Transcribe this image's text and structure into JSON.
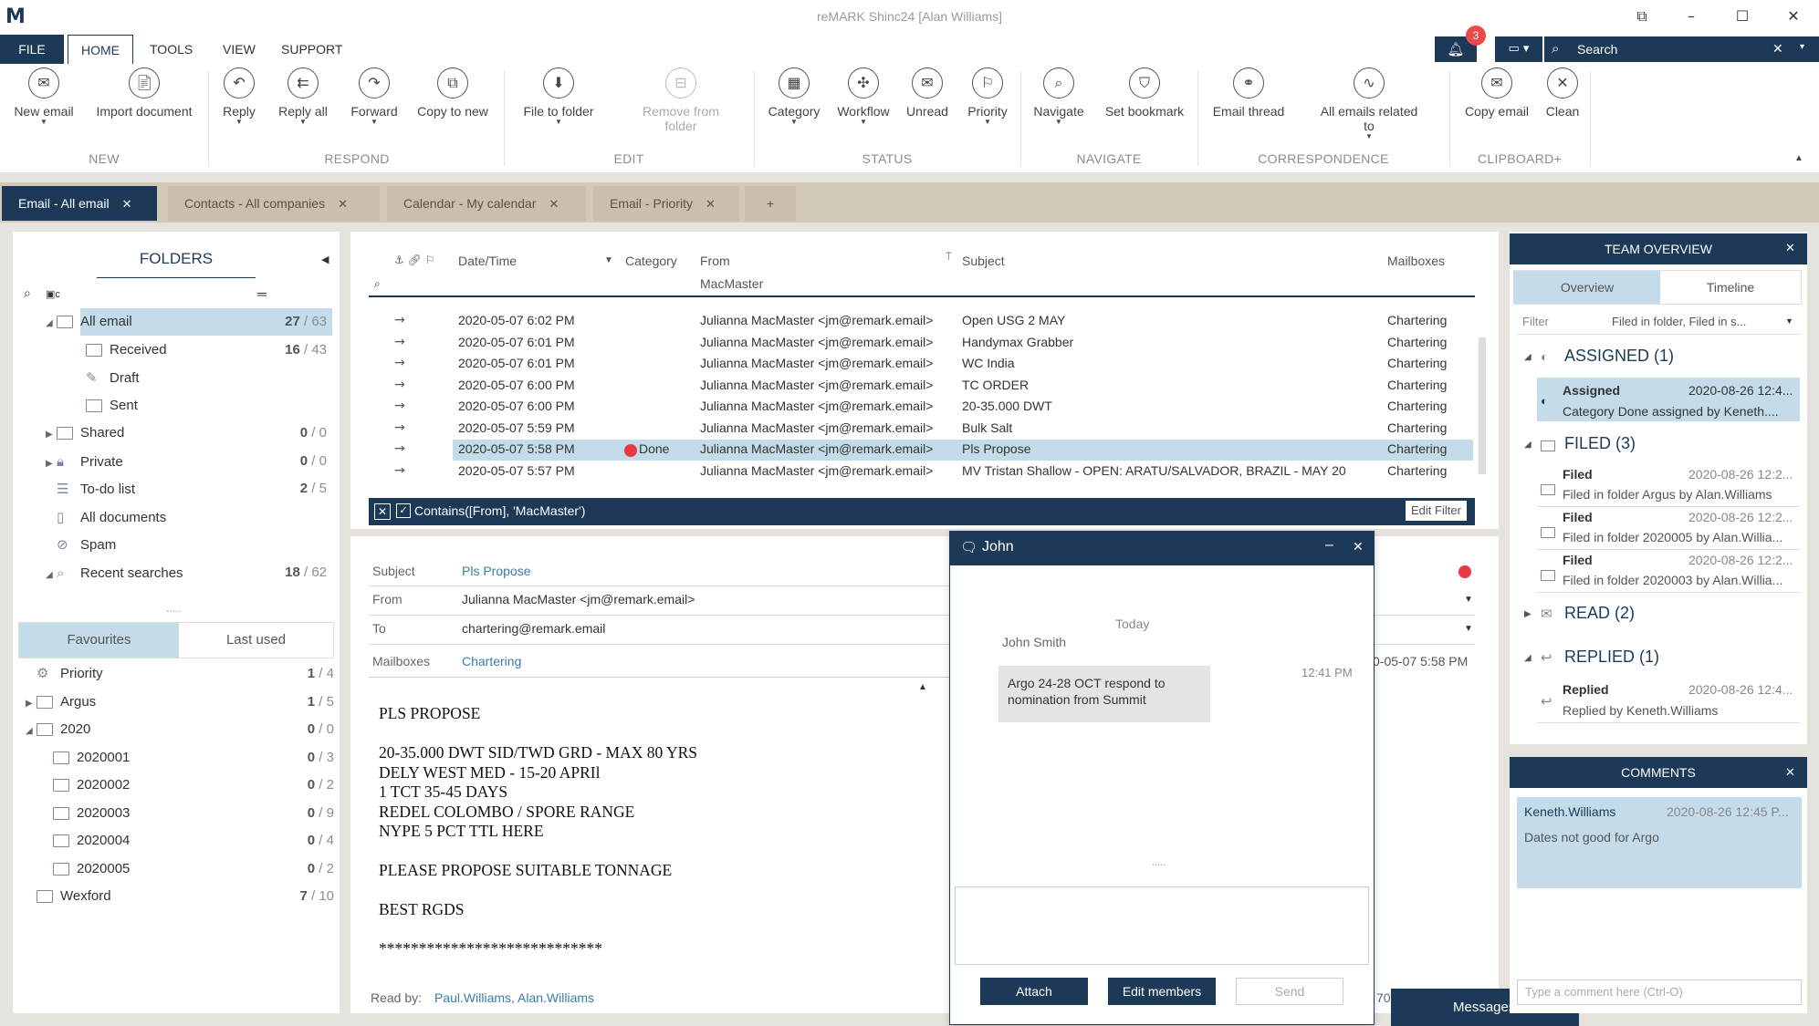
{
  "window": {
    "title": "reMARK Shinc24 [Alan Williams]",
    "logo": "M"
  },
  "menu": {
    "file": "FILE",
    "home": "HOME",
    "tools": "TOOLS",
    "view": "VIEW",
    "support": "SUPPORT"
  },
  "notifications": {
    "count": "3"
  },
  "search": {
    "placeholder": "Search"
  },
  "ribbon": {
    "buttons": [
      {
        "label": "New email"
      },
      {
        "label": "Import document"
      },
      {
        "label": "Reply"
      },
      {
        "label": "Reply all"
      },
      {
        "label": "Forward"
      },
      {
        "label": "Copy to new"
      },
      {
        "label": "File to folder"
      },
      {
        "label": "Remove from folder"
      },
      {
        "label": "Category"
      },
      {
        "label": "Workflow"
      },
      {
        "label": "Unread"
      },
      {
        "label": "Priority"
      },
      {
        "label": "Navigate"
      },
      {
        "label": "Set bookmark"
      },
      {
        "label": "Email thread"
      },
      {
        "label": "All emails related to"
      },
      {
        "label": "Copy email"
      },
      {
        "label": "Clean"
      }
    ],
    "groups": [
      "NEW",
      "RESPOND",
      "EDIT",
      "STATUS",
      "NAVIGATE",
      "CORRESPONDENCE",
      "CLIPBOARD+"
    ]
  },
  "tabs": [
    {
      "label": "Email - All email"
    },
    {
      "label": "Contacts - All companies"
    },
    {
      "label": "Calendar - My calendar"
    },
    {
      "label": "Email - Priority"
    },
    {
      "label": "+"
    }
  ],
  "folders": {
    "title": "FOLDERS",
    "items": [
      {
        "label": "All email",
        "count": "27",
        "total": "63"
      },
      {
        "label": "Received",
        "count": "16",
        "total": "43"
      },
      {
        "label": "Draft"
      },
      {
        "label": "Sent"
      },
      {
        "label": "Shared",
        "count": "0",
        "total": "0"
      },
      {
        "label": "Private",
        "count": "0",
        "total": "0"
      },
      {
        "label": "To-do list",
        "count": "2",
        "total": "5"
      },
      {
        "label": "All documents"
      },
      {
        "label": "Spam"
      },
      {
        "label": "Recent searches",
        "count": "18",
        "total": "62"
      }
    ],
    "more": "....."
  },
  "favourites": {
    "tabs": [
      "Favourites",
      "Last used"
    ],
    "items": [
      {
        "label": "Priority",
        "count": "1",
        "total": "4"
      },
      {
        "label": "Argus",
        "count": "1",
        "total": "5"
      },
      {
        "label": "2020",
        "count": "0",
        "total": "0"
      },
      {
        "label": "2020001",
        "count": "0",
        "total": "3"
      },
      {
        "label": "2020002",
        "count": "0",
        "total": "2"
      },
      {
        "label": "2020003",
        "count": "0",
        "total": "9"
      },
      {
        "label": "2020004",
        "count": "0",
        "total": "4"
      },
      {
        "label": "2020005",
        "count": "0",
        "total": "2"
      },
      {
        "label": "Wexford",
        "count": "7",
        "total": "10"
      }
    ]
  },
  "email_list": {
    "columns": {
      "datetime": "Date/Time",
      "category": "Category",
      "from": "From",
      "subject": "Subject",
      "mailboxes": "Mailboxes"
    },
    "from_filter": "MacMaster",
    "rows": [
      {
        "date": "2020-05-07 6:02 PM",
        "category": "",
        "from": "Julianna MacMaster <jm@remark.email>",
        "subject": "Open USG 2 MAY",
        "mailbox": "Chartering"
      },
      {
        "date": "2020-05-07 6:01 PM",
        "category": "",
        "from": "Julianna MacMaster <jm@remark.email>",
        "subject": "Handymax Grabber",
        "mailbox": "Chartering"
      },
      {
        "date": "2020-05-07 6:01 PM",
        "category": "",
        "from": "Julianna MacMaster <jm@remark.email>",
        "subject": "WC India",
        "mailbox": "Chartering"
      },
      {
        "date": "2020-05-07 6:00 PM",
        "category": "",
        "from": "Julianna MacMaster <jm@remark.email>",
        "subject": "TC ORDER",
        "mailbox": "Chartering"
      },
      {
        "date": "2020-05-07 6:00 PM",
        "category": "",
        "from": "Julianna MacMaster <jm@remark.email>",
        "subject": "20-35.000 DWT",
        "mailbox": "Chartering"
      },
      {
        "date": "2020-05-07 5:59 PM",
        "category": "",
        "from": "Julianna MacMaster <jm@remark.email>",
        "subject": "Bulk Salt",
        "mailbox": "Chartering"
      },
      {
        "date": "2020-05-07 5:58 PM",
        "category": "Done",
        "from": "Julianna MacMaster <jm@remark.email>",
        "subject": "Pls Propose",
        "mailbox": "Chartering"
      },
      {
        "date": "2020-05-07 5:57 PM",
        "category": "",
        "from": "Julianna MacMaster <jm@remark.email>",
        "subject": "MV Tristan Shallow - OPEN: ARATU/SALVADOR, BRAZIL - MAY 20",
        "mailbox": "Chartering"
      }
    ],
    "filter_text": "Contains([From], 'MacMaster')",
    "edit_filter": "Edit Filter"
  },
  "preview": {
    "labels": {
      "subject": "Subject",
      "from": "From",
      "to": "To",
      "mailboxes": "Mailboxes"
    },
    "subject": "Pls Propose",
    "from": "Julianna MacMaster <jm@remark.email>",
    "to": "chartering@remark.email",
    "mailbox": "Chartering",
    "date_partial": "0-05-07 5:58 PM",
    "body": [
      "PLS PROPOSE",
      "",
      "20-35.000 DWT SID/TWD GRD - MAX 80 YRS",
      "DELY WEST MED - 15-20 APRIl",
      "1 TCT 35-45 DAYS",
      "REDEL COLOMBO / SPORE RANGE",
      "NYPE 5 PCT TTL HERE",
      "",
      "PLEASE PROPOSE SUITABLE TONNAGE",
      "",
      "BEST RGDS",
      "",
      "****************************"
    ],
    "read_by_label": "Read by:",
    "read_by": "Paul.Williams, Alan.Williams",
    "partial_bottom": "70"
  },
  "chat": {
    "title": "John",
    "day": "Today",
    "sender": "John Smith",
    "time": "12:41 PM",
    "message": "Argo 24-28 OCT respond to nomination from Summit",
    "dots": ".....",
    "buttons": {
      "attach": "Attach",
      "edit_members": "Edit members",
      "send": "Send"
    }
  },
  "messages_bar": {
    "label": "Messages"
  },
  "team_overview": {
    "title": "TEAM OVERVIEW",
    "tabs": [
      "Overview",
      "Timeline"
    ],
    "filter_label": "Filter",
    "filter_value": "Filed in folder, Filed in s...",
    "sections": {
      "assigned": "ASSIGNED (1)",
      "filed": "FILED (3)",
      "read": "READ (2)",
      "replied": "REPLIED (1)"
    },
    "assigned_items": [
      {
        "title": "Assigned",
        "time": "2020-08-26 12:4...",
        "text": "Category Done assigned by Keneth...."
      }
    ],
    "filed_items": [
      {
        "title": "Filed",
        "time": "2020-08-26 12:2...",
        "text": "Filed in folder Argus by Alan.Williams"
      },
      {
        "title": "Filed",
        "time": "2020-08-26 12:2...",
        "text": "Filed in folder 2020005 by Alan.Willia..."
      },
      {
        "title": "Filed",
        "time": "2020-08-26 12:2...",
        "text": "Filed in folder 2020003 by Alan.Willia..."
      }
    ],
    "replied_items": [
      {
        "title": "Replied",
        "time": "2020-08-26 12:4...",
        "text": "Replied by Keneth.Williams"
      }
    ]
  },
  "comments": {
    "title": "COMMENTS",
    "author": "Keneth.Williams",
    "time": "2020-08-26 12:45 P...",
    "text": "Dates not good for Argo",
    "placeholder": "Type a comment here (Ctrl-O)"
  },
  "colors": {
    "accent": "#1c3a57",
    "selection": "#c4dce9",
    "done": "#e53946"
  }
}
